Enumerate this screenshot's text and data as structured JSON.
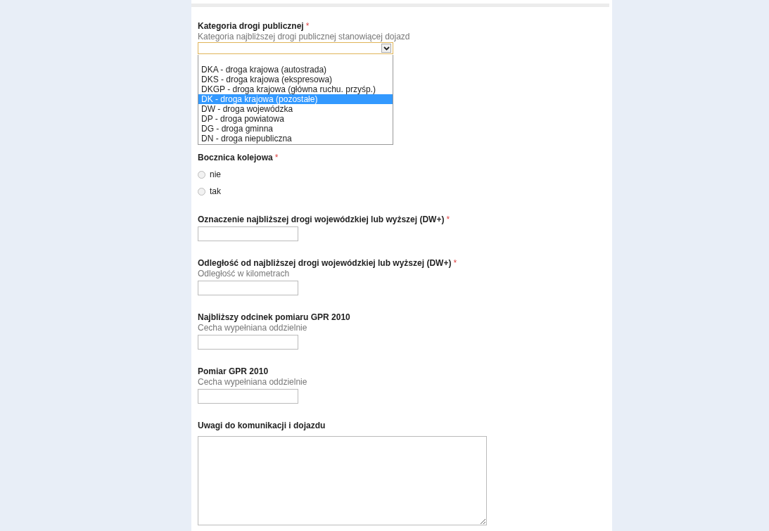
{
  "fields": [
    {
      "kind": "select",
      "label": "Kategoria drogi publicznej",
      "required_mark": "*",
      "hint": "Kategoria najbliższej drogi publicznej stanowiącej dojazd",
      "open": true,
      "options": [
        {
          "label": "DKA - droga krajowa (autostrada)",
          "selected": false
        },
        {
          "label": "DKS - droga krajowa (ekspresowa)",
          "selected": false
        },
        {
          "label": "DKGP - droga krajowa (główna ruchu. przyśp.)",
          "selected": false
        },
        {
          "label": "DK - droga krajowa (pozostałe)",
          "selected": true
        },
        {
          "label": "DW - droga wojewódzka",
          "selected": false
        },
        {
          "label": "DP - droga powiatowa",
          "selected": false
        },
        {
          "label": "DG - droga gminna",
          "selected": false
        },
        {
          "label": "DN - droga niepubliczna",
          "selected": false
        }
      ]
    },
    {
      "kind": "radio",
      "label": "Bocznica kolejowa",
      "required_mark": "*",
      "options": [
        {
          "label": "nie",
          "selected": false
        },
        {
          "label": "tak",
          "selected": false
        }
      ]
    },
    {
      "kind": "text",
      "label": "Oznaczenie najbliższej drogi wojewódzkiej lub wyższej (DW+)",
      "required_mark": "*"
    },
    {
      "kind": "text",
      "label": "Odległość od najbliższej drogi wojewódzkiej lub wyższej (DW+)",
      "required_mark": "*",
      "hint": "Odległość w kilometrach"
    },
    {
      "kind": "text",
      "label": "Najbliższy odcinek pomiaru GPR 2010",
      "hint": "Cecha wypełniana oddzielnie"
    },
    {
      "kind": "text",
      "label": "Pomiar GPR 2010",
      "hint": "Cecha wypełniana oddzielnie"
    },
    {
      "kind": "textarea",
      "label": "Uwagi do komunikacji i dojazdu"
    }
  ]
}
